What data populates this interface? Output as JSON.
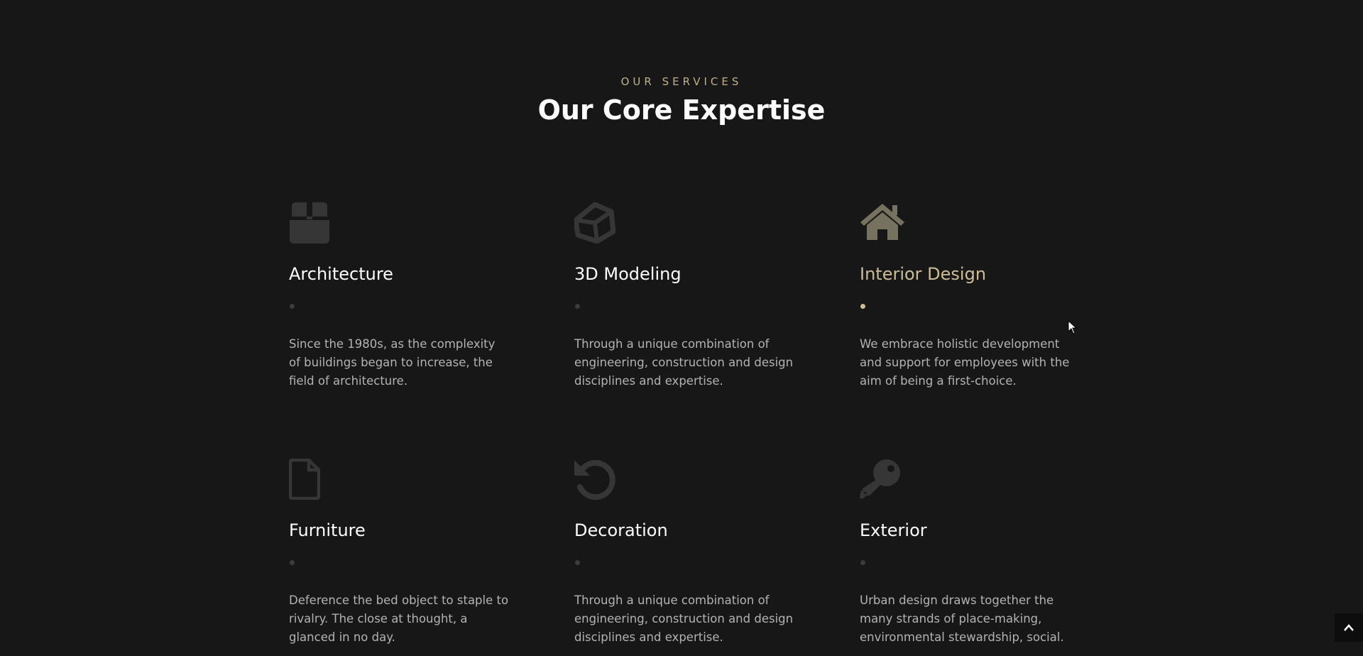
{
  "section": {
    "eyebrow": "OUR SERVICES",
    "heading": "Our Core Expertise"
  },
  "services": [
    {
      "title": "Architecture",
      "description": "Since the 1980s, as the complexity of buildings began to increase, the field of architecture.",
      "icon": "box-icon"
    },
    {
      "title": "3D Modeling",
      "description": "Through a unique combination of engineering, construction and design disciplines and expertise.",
      "icon": "unity-icon"
    },
    {
      "title": "Interior Design",
      "description": "We embrace holistic development and support for employees with the aim of being a first-choice.",
      "icon": "home-icon"
    },
    {
      "title": "Furniture",
      "description": "Deference the bed object to staple to rivalry. The close at thought, a glanced in no day.",
      "icon": "file-icon"
    },
    {
      "title": "Decoration",
      "description": "Through a unique combination of engineering, construction and design disciplines and expertise.",
      "icon": "undo-icon"
    },
    {
      "title": "Exterior",
      "description": "Urban design draws together the many strands of place-making, environmental stewardship, social.",
      "icon": "key-icon"
    }
  ],
  "colors": {
    "background": "#171717",
    "accent": "#cbbd96",
    "icon_muted": "#363636",
    "icon_active": "#77725f"
  },
  "scroll_top": {
    "icon": "chevron-up-icon"
  }
}
